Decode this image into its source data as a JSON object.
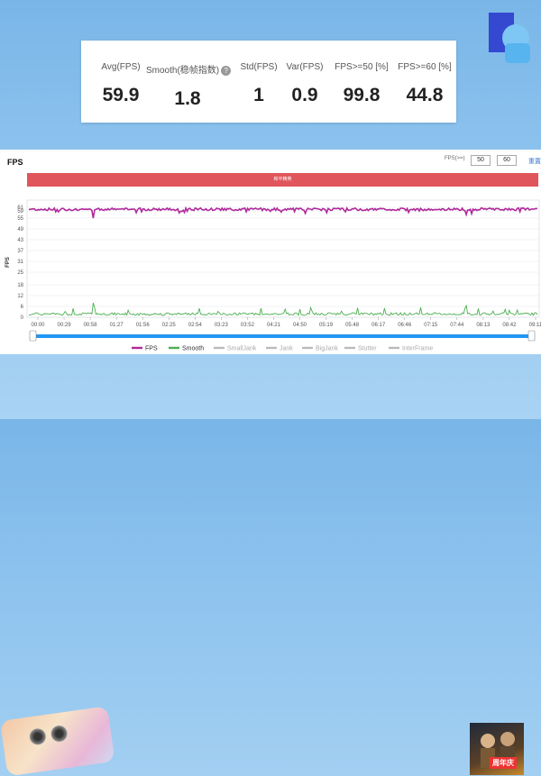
{
  "stats": [
    {
      "label": "Avg(FPS)",
      "value": "59.9"
    },
    {
      "label": "Smooth(稳帧指数)",
      "value": "1.8",
      "help": "?"
    },
    {
      "label": "Std(FPS)",
      "value": "1"
    },
    {
      "label": "Var(FPS)",
      "value": "0.9"
    },
    {
      "label": "FPS>=50 [%]",
      "value": "99.8"
    },
    {
      "label": "FPS>=60 [%]",
      "value": "44.8"
    }
  ],
  "panel": {
    "title": "FPS",
    "fps_ctrl_label": "FPS(>=)",
    "fps_threshold_1": "50",
    "fps_threshold_2": "60",
    "reset_label": "重置",
    "banner_text": "和平精英"
  },
  "chart_data": {
    "type": "line",
    "ylabel": "FPS",
    "ylim": [
      0,
      61
    ],
    "yticks": [
      "61",
      "59",
      "55",
      "49",
      "43",
      "37",
      "31",
      "25",
      "18",
      "12",
      "6",
      "0"
    ],
    "xticks": [
      "00:00",
      "00:29",
      "00:58",
      "01:27",
      "01:56",
      "02:25",
      "02:54",
      "03:23",
      "03:52",
      "04:21",
      "04:50",
      "05:19",
      "05:48",
      "06:17",
      "06:46",
      "07:15",
      "07:44",
      "08:13",
      "08:42",
      "09:11"
    ],
    "series": [
      {
        "name": "FPS",
        "color": "#b0299b",
        "typical": 59.9,
        "min_dip": 55
      },
      {
        "name": "Smooth",
        "color": "#4caf50",
        "typical": 1.8,
        "max_spike": 8
      }
    ],
    "legend": [
      {
        "name": "FPS",
        "color": "#b0299b",
        "active": true
      },
      {
        "name": "Smooth",
        "color": "#4caf50",
        "active": true
      },
      {
        "name": "SmallJank",
        "color": "#bbbbbb",
        "active": false
      },
      {
        "name": "Jank",
        "color": "#bbbbbb",
        "active": false
      },
      {
        "name": "BigJank",
        "color": "#bbbbbb",
        "active": false
      },
      {
        "name": "Stutter",
        "color": "#bbbbbb",
        "active": false
      },
      {
        "name": "InterFrame",
        "color": "#bbbbbb",
        "active": false
      }
    ],
    "legend_position": "bottom"
  },
  "colors": {
    "fps_line": "#b0299b",
    "smooth_line": "#4caf50",
    "banner": "#e0555b",
    "scroll_bar": "#2196f3"
  }
}
